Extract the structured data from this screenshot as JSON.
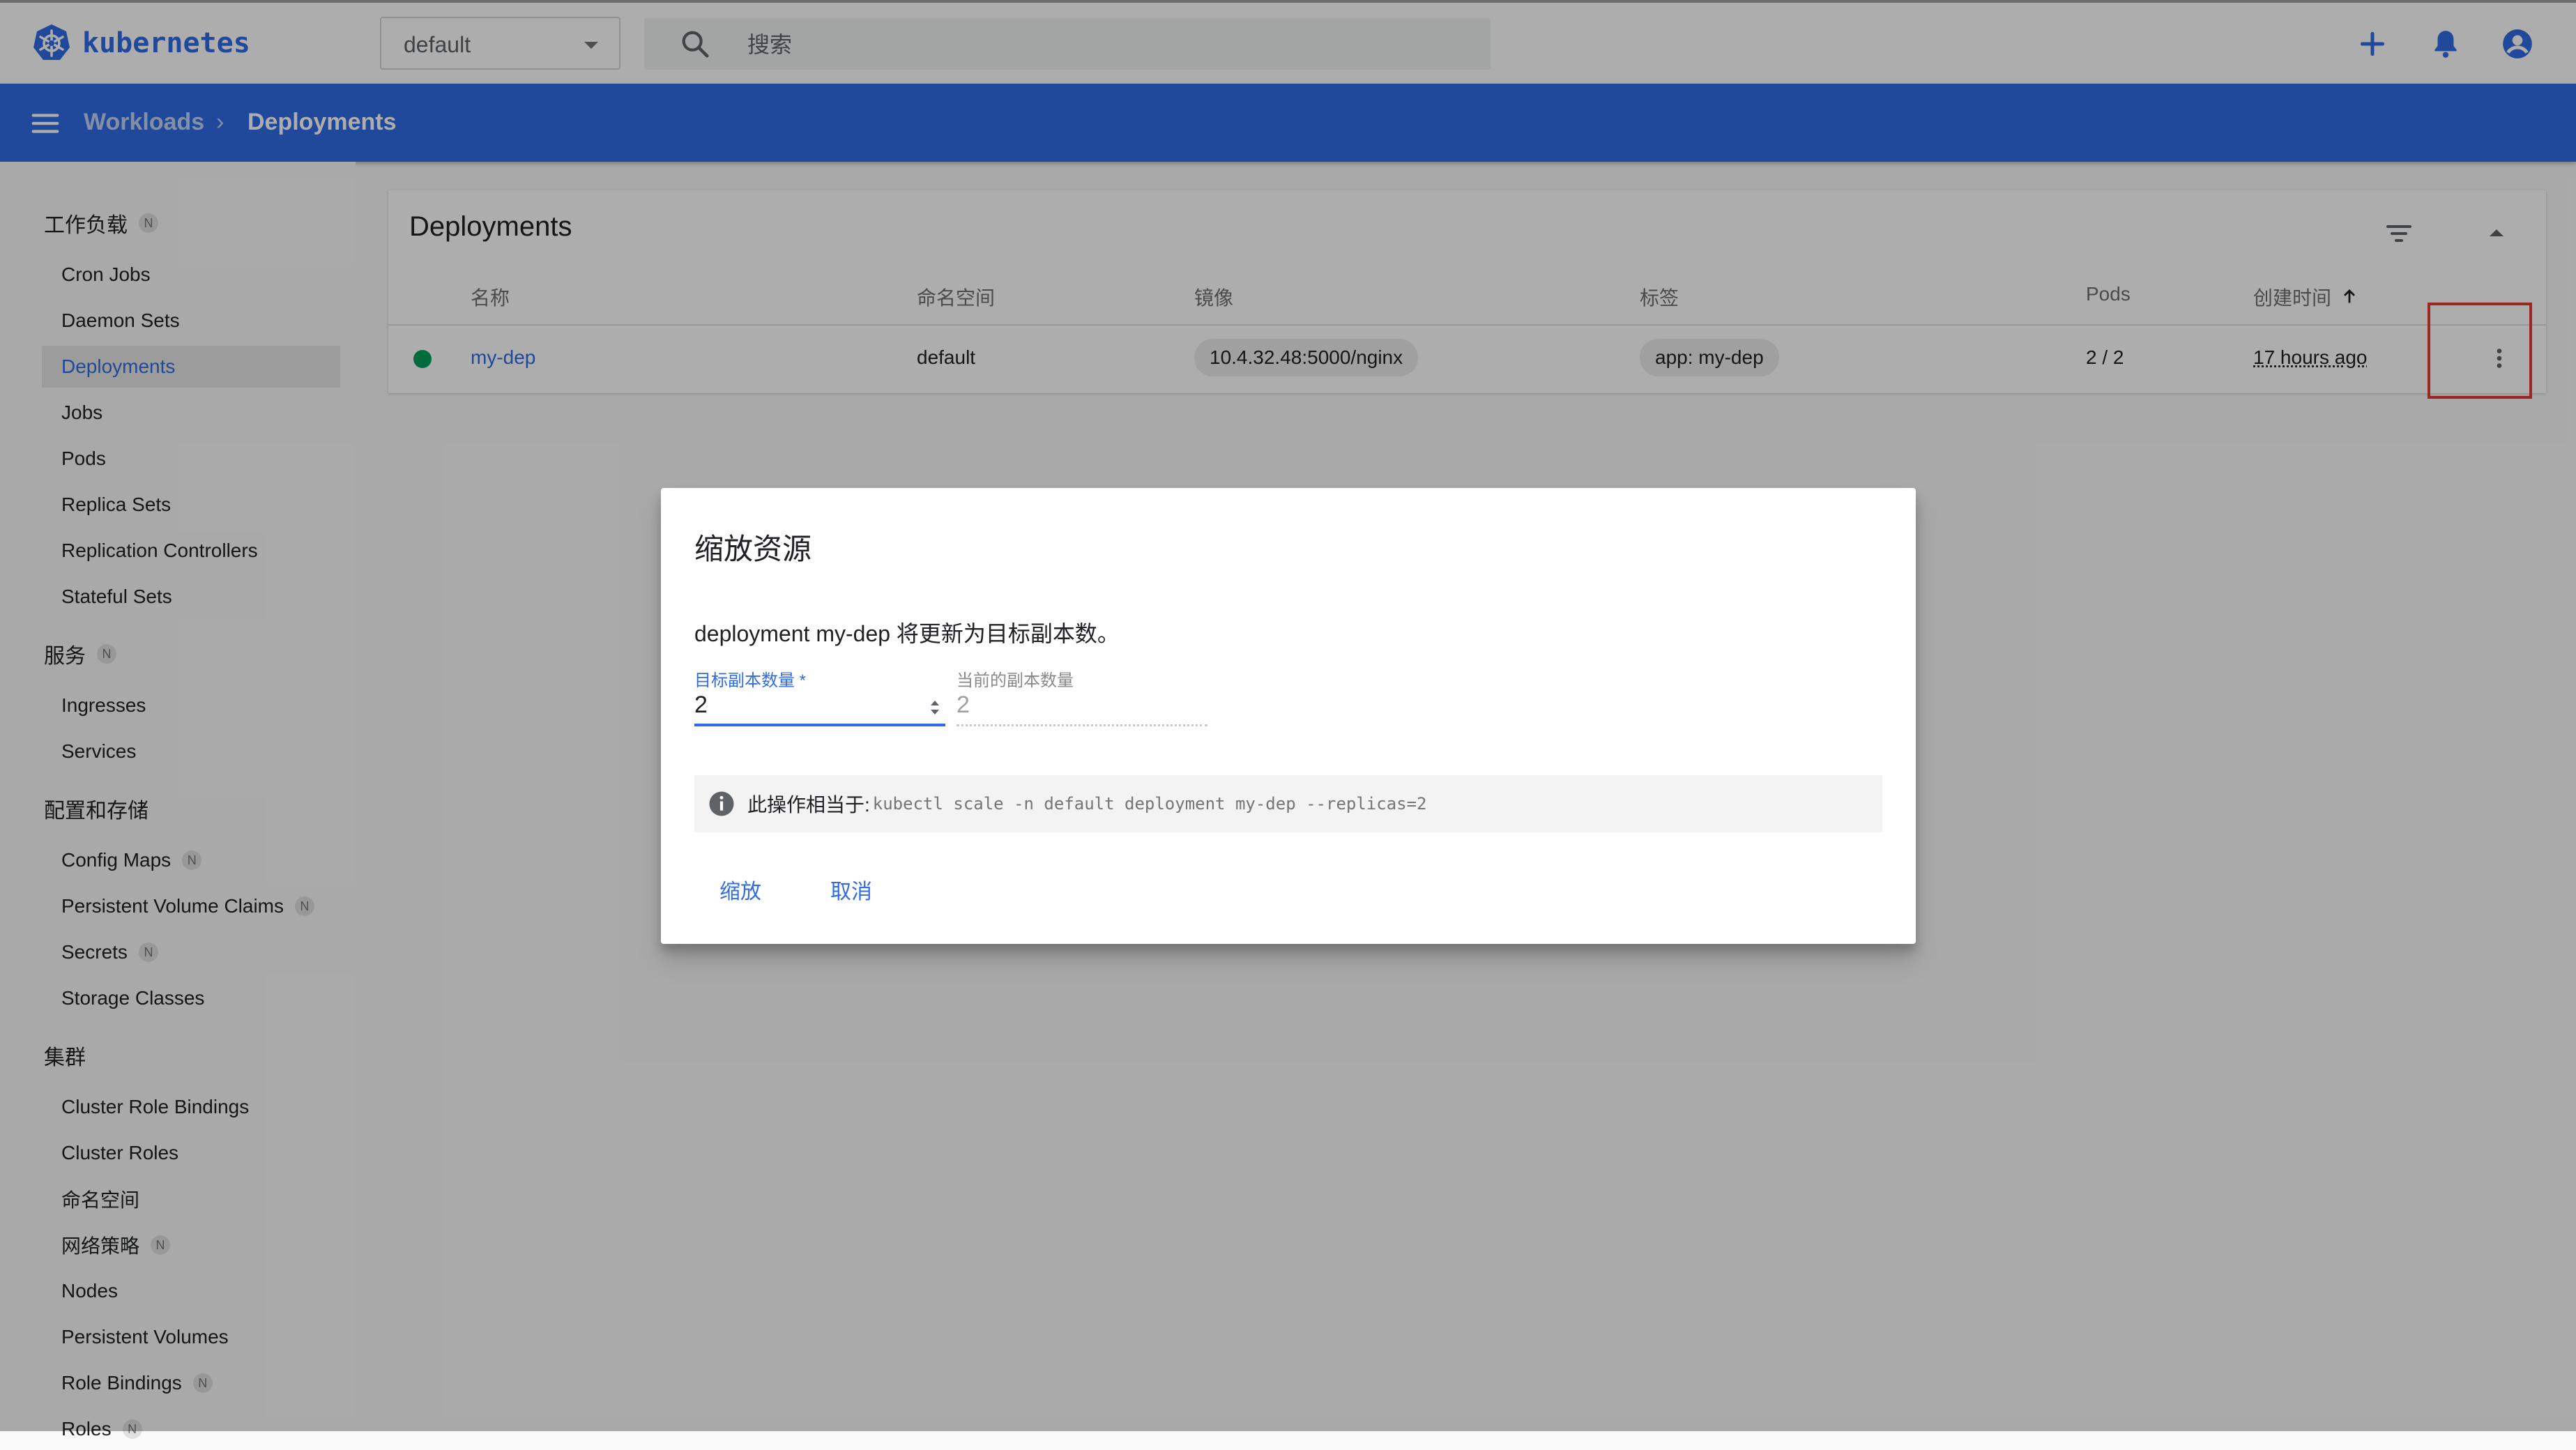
{
  "header": {
    "logo_text": "kubernetes",
    "namespace": "default",
    "search_placeholder": "搜索",
    "brand_color": "#326ce5"
  },
  "breadcrumb": {
    "parent": "Workloads",
    "separator": "›",
    "current": "Deployments"
  },
  "sidebar": {
    "badge": "N",
    "groups": {
      "workloads": "工作负载",
      "services": "服务",
      "config": "配置和存储",
      "cluster": "集群"
    },
    "items": {
      "cron_jobs": "Cron Jobs",
      "daemon_sets": "Daemon Sets",
      "deployments": "Deployments",
      "jobs": "Jobs",
      "pods": "Pods",
      "replica_sets": "Replica Sets",
      "replication_controllers": "Replication Controllers",
      "stateful_sets": "Stateful Sets",
      "ingresses": "Ingresses",
      "services": "Services",
      "config_maps": "Config Maps",
      "pvcs": "Persistent Volume Claims",
      "secrets": "Secrets",
      "storage_classes": "Storage Classes",
      "cluster_role_bindings": "Cluster Role Bindings",
      "cluster_roles": "Cluster Roles",
      "namespaces": "命名空间",
      "network_policies": "网络策略",
      "nodes": "Nodes",
      "persistent_volumes": "Persistent Volumes",
      "role_bindings": "Role Bindings",
      "roles": "Roles"
    }
  },
  "card": {
    "title": "Deployments",
    "columns": {
      "name": "名称",
      "namespace": "命名空间",
      "image": "镜像",
      "labels": "标签",
      "pods": "Pods",
      "created": "创建时间"
    },
    "rows": [
      {
        "status": "running",
        "name": "my-dep",
        "namespace": "default",
        "image": "10.4.32.48:5000/nginx",
        "label": "app: my-dep",
        "pods": "2 / 2",
        "created": "17 hours ago"
      }
    ]
  },
  "dialog": {
    "title": "缩放资源",
    "message": "deployment my-dep 将更新为目标副本数。",
    "target_label": "目标副本数量 *",
    "target_value": "2",
    "current_label": "当前的副本数量",
    "current_value": "2",
    "equiv_label": "此操作相当于:",
    "equiv_command": "kubectl scale -n default deployment my-dep --replicas=2",
    "scale_button": "缩放",
    "cancel_button": "取消"
  },
  "colors": {
    "accent": "#326ce5",
    "status_ok": "#00a05a",
    "highlight": "#e53935"
  }
}
